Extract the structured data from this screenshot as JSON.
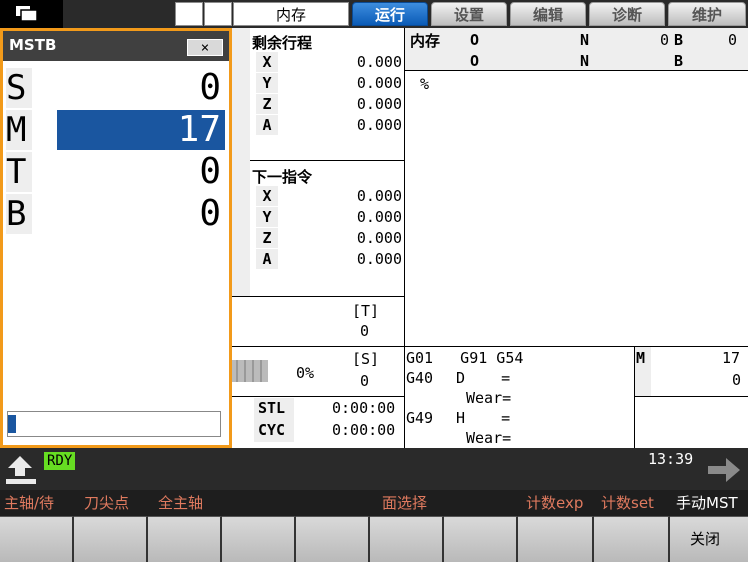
{
  "tabs": {
    "memory": "内存",
    "run": "运行",
    "setup": "设置",
    "edit": "编辑",
    "diagnosis": "诊断",
    "maintenance": "维护"
  },
  "mstb": {
    "title": "MSTB",
    "close": "×",
    "rows": [
      {
        "label": "S",
        "value": "0"
      },
      {
        "label": "M",
        "value": "17"
      },
      {
        "label": "T",
        "value": "0"
      },
      {
        "label": "B",
        "value": "0"
      }
    ],
    "input_value": ""
  },
  "remaining": {
    "title": "剩余行程",
    "axes": [
      {
        "axis": "X",
        "value": "0.000"
      },
      {
        "axis": "Y",
        "value": "0.000"
      },
      {
        "axis": "Z",
        "value": "0.000"
      },
      {
        "axis": "A",
        "value": "0.000"
      }
    ]
  },
  "next_cmd": {
    "title": "下一指令",
    "axes": [
      {
        "axis": "X",
        "value": "0.000"
      },
      {
        "axis": "Y",
        "value": "0.000"
      },
      {
        "axis": "Z",
        "value": "0.000"
      },
      {
        "axis": "A",
        "value": "0.000"
      }
    ]
  },
  "tool": {
    "label": "[T]",
    "value": "0"
  },
  "spindle": {
    "percent": "0%",
    "label": "[S]",
    "value": "0"
  },
  "timers": [
    {
      "label": "STL",
      "value": "0:00:00"
    },
    {
      "label": "CYC",
      "value": "0:00:00"
    }
  ],
  "program": {
    "title": "内存",
    "o_label": "O",
    "n_label": "N",
    "n_value": "0",
    "b_label": "B",
    "b_value": "0",
    "o2_label": "O",
    "n2_label": "N",
    "b2_label": "B",
    "percent": "%"
  },
  "modal": {
    "line1": "G01   G91 G54",
    "line2_a": "G40",
    "line2_b": "D    =",
    "line3": "Wear=",
    "line4_a": "G49",
    "line4_b": "H    =",
    "line5": "Wear=",
    "m_label": "M",
    "m_value1": "17",
    "m_value2": "0"
  },
  "status": {
    "rdy": "RDY",
    "time": "13:39"
  },
  "softkeys": {
    "sk1": "主轴/待",
    "sk2": "刀尖点",
    "sk3": "全主轴",
    "sk4": "面选择",
    "sk5": "计数exp",
    "sk6": "计数set",
    "sk7": "手动MST",
    "close": "关闭"
  }
}
